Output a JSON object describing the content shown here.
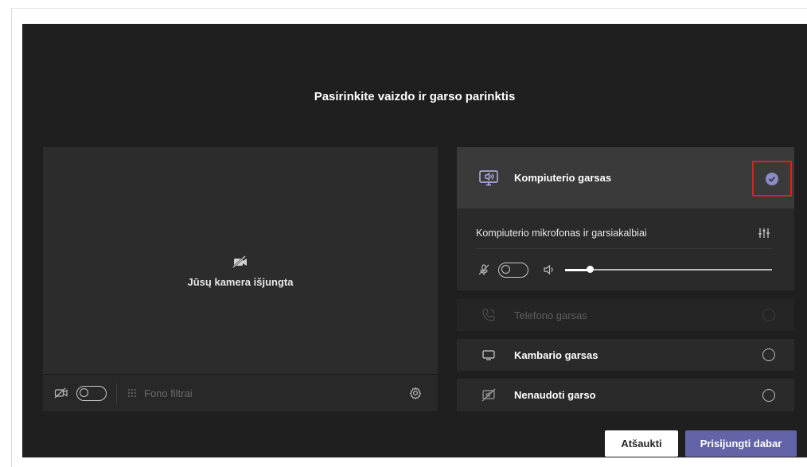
{
  "dialog": {
    "title": "Pasirinkite vaizdo ir garso parinktis"
  },
  "video": {
    "camera_status": "Jūsų kamera išjungta",
    "camera_toggle_on": false,
    "background_filters_label": "Fono filtrai"
  },
  "audio_options": {
    "computer": {
      "label": "Kompiuterio garsas",
      "selected": true,
      "device_label": "Kompiuterio mikrofonas ir garsiakalbiai",
      "mic_toggle_on": false,
      "volume_level": 0.12
    },
    "phone": {
      "label": "Telefono garsas",
      "enabled": false
    },
    "room": {
      "label": "Kambario garsas"
    },
    "none": {
      "label": "Nenaudoti garso"
    }
  },
  "buttons": {
    "cancel": "Atšaukti",
    "join": "Prisijungti dabar"
  },
  "colors": {
    "dialog_bg": "#201f1f",
    "accent": "#6264a7",
    "selection_check": "#8b8cc7",
    "highlight_box": "#e0201c"
  }
}
